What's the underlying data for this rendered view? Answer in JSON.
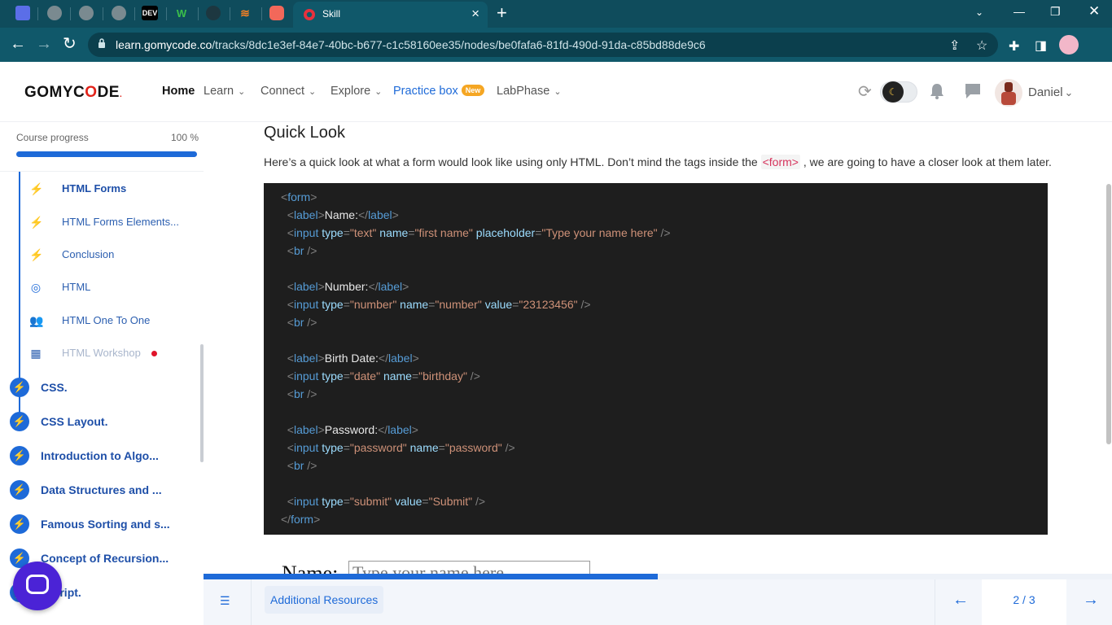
{
  "browser": {
    "tab_title": "Skill",
    "tab_icons": [
      "gomycode-icon",
      "globe-icon",
      "globe-icon",
      "globe-icon",
      "dev-icon",
      "w-icon",
      "github-icon",
      "stackoverflow-icon",
      "scrimba-icon"
    ],
    "dev_label": "DEV",
    "w_label": "W",
    "url_host": "learn.gomycode.co",
    "url_path": "/tracks/8dc1e3ef-84e7-40bc-b677-c1c58160ee35/nodes/be0fafa6-81fd-490d-91da-c85bd88de9c6"
  },
  "header": {
    "logo_part1": "GOMYC",
    "logo_o": "O",
    "logo_part2": "DE",
    "logo_dot": ".",
    "menu": {
      "home": "Home",
      "learn": "Learn",
      "connect": "Connect",
      "explore": "Explore",
      "practice": "Practice box",
      "practice_badge": "New",
      "labphase": "LabPhase"
    },
    "username": "Daniel"
  },
  "sidebar": {
    "progress_label": "Course progress",
    "progress_value": "100 %",
    "progress_fraction": 1.0,
    "sub_items": [
      {
        "label": "HTML Forms",
        "icon": "bolt-icon",
        "state": "current"
      },
      {
        "label": "HTML Forms Elements...",
        "icon": "bolt-icon",
        "state": "normal"
      },
      {
        "label": "Conclusion",
        "icon": "bolt-icon",
        "state": "normal"
      },
      {
        "label": "HTML",
        "icon": "target-icon",
        "state": "normal"
      },
      {
        "label": "HTML One To One",
        "icon": "people-icon",
        "state": "normal"
      },
      {
        "label": "HTML Workshop",
        "icon": "workshop-icon",
        "state": "locked"
      }
    ],
    "modules": [
      {
        "label": "CSS."
      },
      {
        "label": "CSS Layout."
      },
      {
        "label": "Introduction to Algo..."
      },
      {
        "label": "Data Structures and ..."
      },
      {
        "label": "Famous Sorting and s..."
      },
      {
        "label": "Concept of Recursion..."
      },
      {
        "label": "ascript."
      }
    ]
  },
  "main": {
    "title": "Quick Look",
    "intro_before": "Here’s a quick look at what a form would look like using only HTML. Don’t mind the tags inside the ",
    "intro_code": "<form>",
    "intro_after": " , we are going to have a closer look at them later.",
    "code": {
      "l01": {
        "a": "<",
        "b": "form",
        "c": ">"
      },
      "l02": {
        "a": "  <",
        "b": "label",
        "c": ">",
        "d": "Name:",
        "e": "</",
        "f": "label",
        "g": ">"
      },
      "l03": {
        "a": "  <",
        "b": "input",
        "c": " type",
        "d": "=",
        "e": "\"text\"",
        "f": " name",
        "g": "=",
        "h": "\"first name\"",
        "i": " placeholder",
        "j": "=",
        "k": "\"Type your name here\"",
        "l": " />"
      },
      "l04": {
        "a": "  <",
        "b": "br",
        "c": " />"
      },
      "l05": {
        "a": "  <",
        "b": "label",
        "c": ">",
        "d": "Number:",
        "e": "</",
        "f": "label",
        "g": ">"
      },
      "l06": {
        "a": "  <",
        "b": "input",
        "c": " type",
        "d": "=",
        "e": "\"number\"",
        "f": " name",
        "g": "=",
        "h": "\"number\"",
        "i": " value",
        "j": "=",
        "k": "\"23123456\"",
        "l": " />"
      },
      "l07": {
        "a": "  <",
        "b": "br",
        "c": " />"
      },
      "l08": {
        "a": "  <",
        "b": "label",
        "c": ">",
        "d": "Birth Date:",
        "e": "</",
        "f": "label",
        "g": ">"
      },
      "l09": {
        "a": "  <",
        "b": "input",
        "c": " type",
        "d": "=",
        "e": "\"date\"",
        "f": " name",
        "g": "=",
        "h": "\"birthday\"",
        "l": " />"
      },
      "l10": {
        "a": "  <",
        "b": "br",
        "c": " />"
      },
      "l11": {
        "a": "  <",
        "b": "label",
        "c": ">",
        "d": "Password:",
        "e": "</",
        "f": "label",
        "g": ">"
      },
      "l12": {
        "a": "  <",
        "b": "input",
        "c": " type",
        "d": "=",
        "e": "\"password\"",
        "f": " name",
        "g": "=",
        "h": "\"password\"",
        "l": " />"
      },
      "l13": {
        "a": "  <",
        "b": "br",
        "c": " />"
      },
      "l14": {
        "a": "  <",
        "b": "input",
        "c": " type",
        "d": "=",
        "e": "\"submit\"",
        "f": " value",
        "g": "=",
        "h": "\"Submit\"",
        "l": " />"
      },
      "l15": {
        "a": "</",
        "b": "form",
        "c": ">"
      }
    },
    "preview_label": "Name:",
    "preview_placeholder": "Type your name here"
  },
  "bottom": {
    "resources_label": "Additional Resources",
    "page_indicator": "2 / 3",
    "reading_progress": 0.5
  },
  "colors": {
    "accent": "#1e6ad8",
    "browser_frame": "#10586a",
    "code_bg": "#1e1e1e",
    "chat_button": "#4b23d6"
  }
}
